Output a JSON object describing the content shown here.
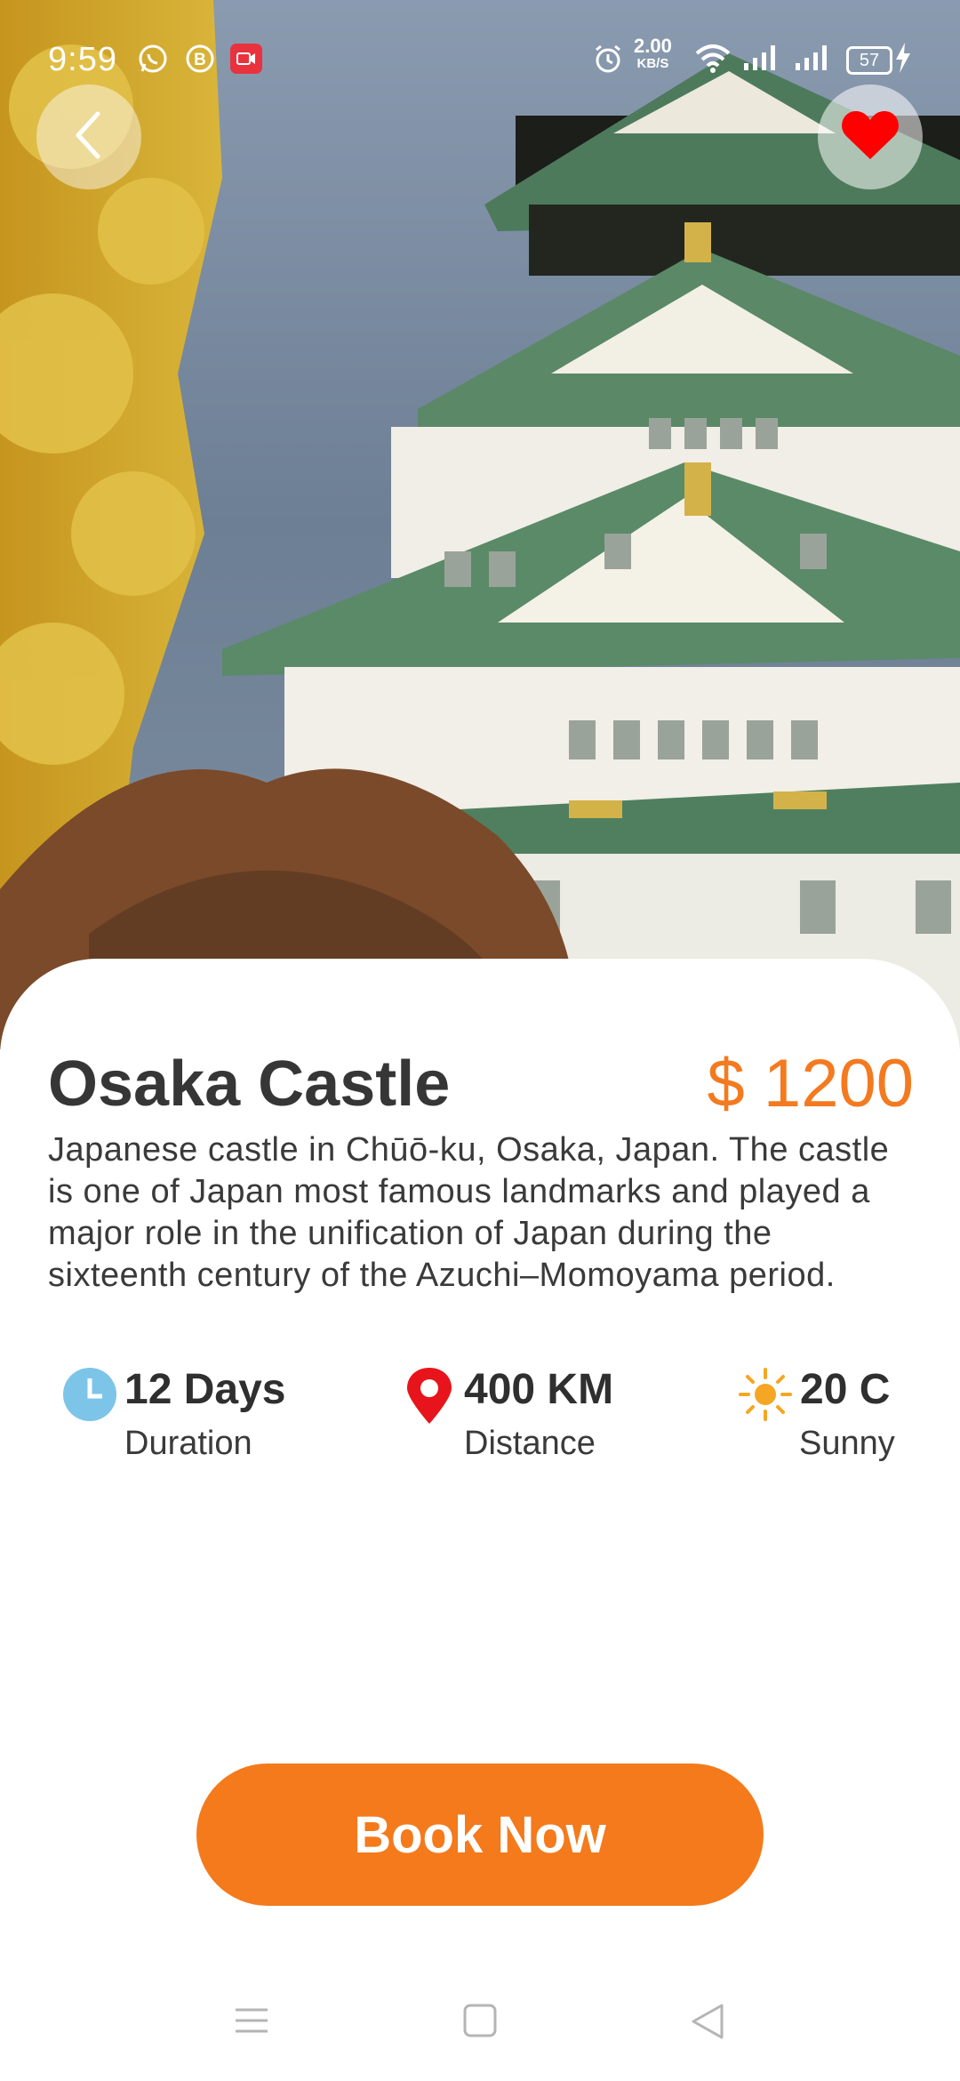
{
  "status_bar": {
    "time": "9:59",
    "speed_value": "2.00",
    "speed_unit": "KB/S",
    "battery": "57",
    "icons": [
      "whatsapp-icon",
      "b-app-icon",
      "screen-record-icon",
      "alarm-icon",
      "wifi-icon",
      "signal-icon",
      "signal-icon",
      "battery-icon",
      "charging-icon"
    ]
  },
  "header": {
    "back_icon": "chevron-left-icon",
    "favorite_icon": "heart-icon",
    "favorite_color": "#ff0000"
  },
  "place": {
    "name": "Osaka Castle",
    "price": "$ 1200",
    "description": "Japanese castle in Chūō-ku, Osaka, Japan. The castle is one of Japan most famous landmarks and played a major role in the unification of Japan during the sixteenth century of the Azuchi–Momoyama period."
  },
  "stats": {
    "duration": {
      "value": "12 Days",
      "label": "Duration",
      "icon": "clock-icon"
    },
    "distance": {
      "value": "400 KM",
      "label": "Distance",
      "icon": "location-pin-icon"
    },
    "weather": {
      "value": "20 C",
      "label": "Sunny",
      "icon": "sun-icon"
    }
  },
  "actions": {
    "book_label": "Book Now"
  },
  "colors": {
    "accent": "#f47a1c",
    "price": "#f47a20",
    "clock": "#7cc5e8",
    "pin": "#e8141b",
    "sun": "#f5a623"
  },
  "nav": {
    "icons": [
      "menu-icon",
      "home-icon",
      "back-triangle-icon"
    ]
  }
}
